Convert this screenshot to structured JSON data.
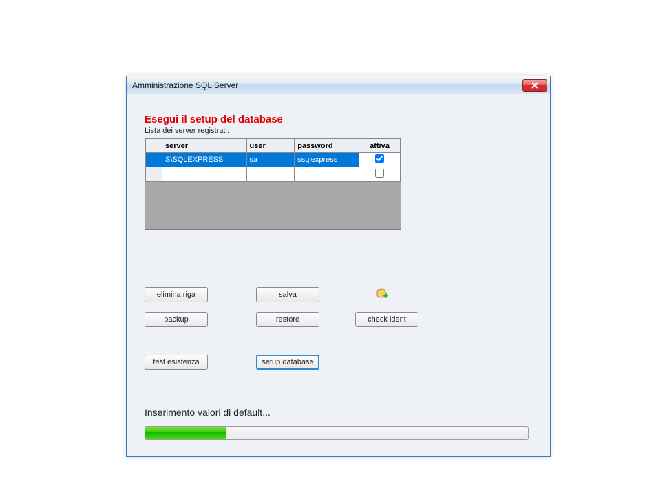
{
  "window": {
    "title": "Amministrazione SQL Server"
  },
  "heading": "Esegui il setup del database",
  "subheading": "Lista dei server registrati:",
  "grid": {
    "headers": {
      "server": "server",
      "user": "user",
      "password": "password",
      "attiva": "attiva"
    },
    "rows": [
      {
        "server": "S\\SQLEXPRESS",
        "user": "sa",
        "password": "ssqlexpress",
        "attiva": true,
        "selected": true
      },
      {
        "server": "",
        "user": "",
        "password": "",
        "attiva": false,
        "selected": false
      }
    ]
  },
  "buttons": {
    "elimina_riga": "elimina riga",
    "salva": "salva",
    "backup": "backup",
    "restore": "restore",
    "check_ident": "check ident",
    "test_esistenza": "test esistenza",
    "setup_database": "setup database"
  },
  "status_text": "Inserimento valori di default...",
  "progress": {
    "percent": 21
  }
}
